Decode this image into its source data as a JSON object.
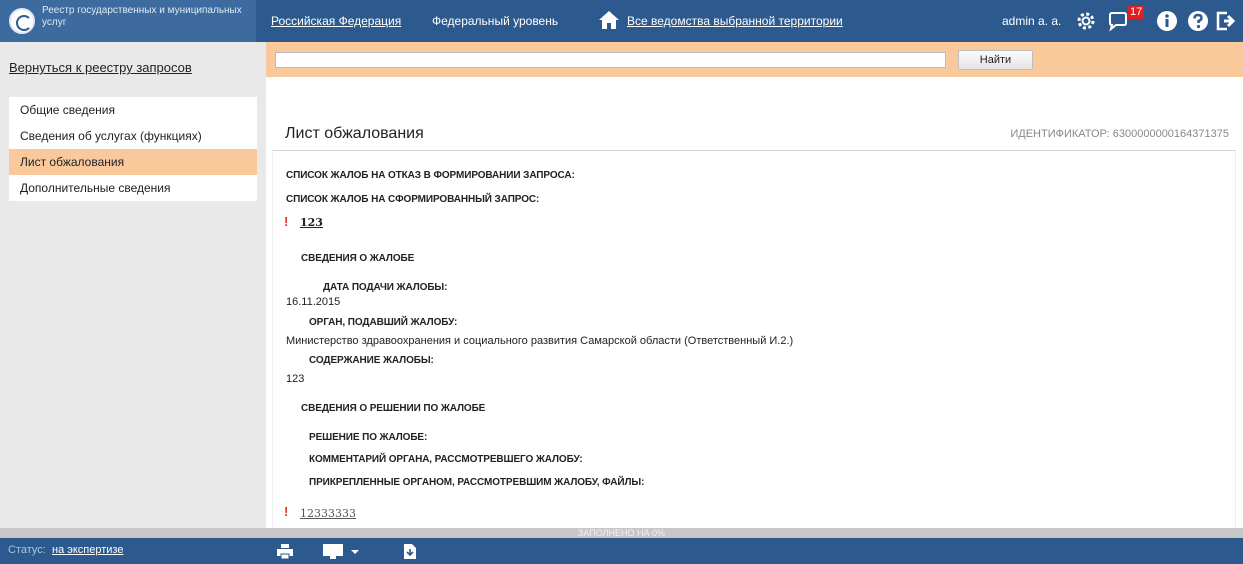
{
  "header": {
    "brand_title": "Реестр государственных и муниципальных услуг",
    "territory_link": "Российская Федерация",
    "level_text": "Федеральный уровень",
    "agencies_link": "Все ведомства выбранной территории",
    "user_name": "admin a. a.",
    "notifications_count": "17",
    "icons": [
      "home-icon",
      "gear-icon",
      "message-icon",
      "info-icon",
      "help-icon",
      "logout-icon"
    ]
  },
  "sidebar": {
    "back_link": "Вернуться к реестру запросов",
    "items": [
      {
        "label": "Общие сведения",
        "active": false
      },
      {
        "label": "Сведения об услугах (функциях)",
        "active": false
      },
      {
        "label": "Лист обжалования",
        "active": true
      },
      {
        "label": "Дополнительные сведения",
        "active": false
      }
    ]
  },
  "search": {
    "value": "",
    "button_label": "Найти"
  },
  "main": {
    "title": "Лист обжалования",
    "identifier": "ИДЕНТИФИКАТОР: 6300000000164371375",
    "refusal_complaints_label": "СПИСОК ЖАЛОБ НА ОТКАЗ В ФОРМИРОВАНИИ ЗАПРОСА:",
    "formed_complaints_label": "СПИСОК ЖАЛОБ НА СФОРМИРОВАННЫЙ ЗАПРОС:",
    "complaint_1": "123",
    "complaint_info_label": "СВЕДЕНИЯ О ЖАЛОБЕ",
    "submit_date_label": "ДАТА ПОДАЧИ ЖАЛОБЫ:",
    "submit_date_value": "16.11.2015",
    "organ_label": "ОРГАН, ПОДАВШИЙ ЖАЛОБУ:",
    "organ_value": "Министерство здравоохранения и социального развития Самарской области (Ответственный И.2.)",
    "content_label": "СОДЕРЖАНИЕ ЖАЛОБЫ:",
    "content_value": "123",
    "decision_info_label": "СВЕДЕНИЯ О РЕШЕНИИ ПО ЖАЛОБЕ",
    "decision_label": "РЕШЕНИЕ ПО ЖАЛОБЕ:",
    "comment_label": "КОММЕНТАРИЙ ОРГАНА, РАССМОТРЕВШЕГО ЖАЛОБУ:",
    "files_label": "ПРИКРЕПЛЕННЫЕ ОРГАНОМ, РАССМОТРЕВШИМ ЖАЛОБУ, ФАЙЛЫ:",
    "complaint_2": "12333333",
    "exclamation": "!"
  },
  "progress": {
    "text": "ЗАПОЛНЕНО НА 0%",
    "percent": 0
  },
  "status": {
    "label": "Статус:",
    "value": "на экспертизе",
    "icons": [
      "print-icon",
      "monitor-icon",
      "dropdown-arrow-icon",
      "download-icon"
    ]
  }
}
